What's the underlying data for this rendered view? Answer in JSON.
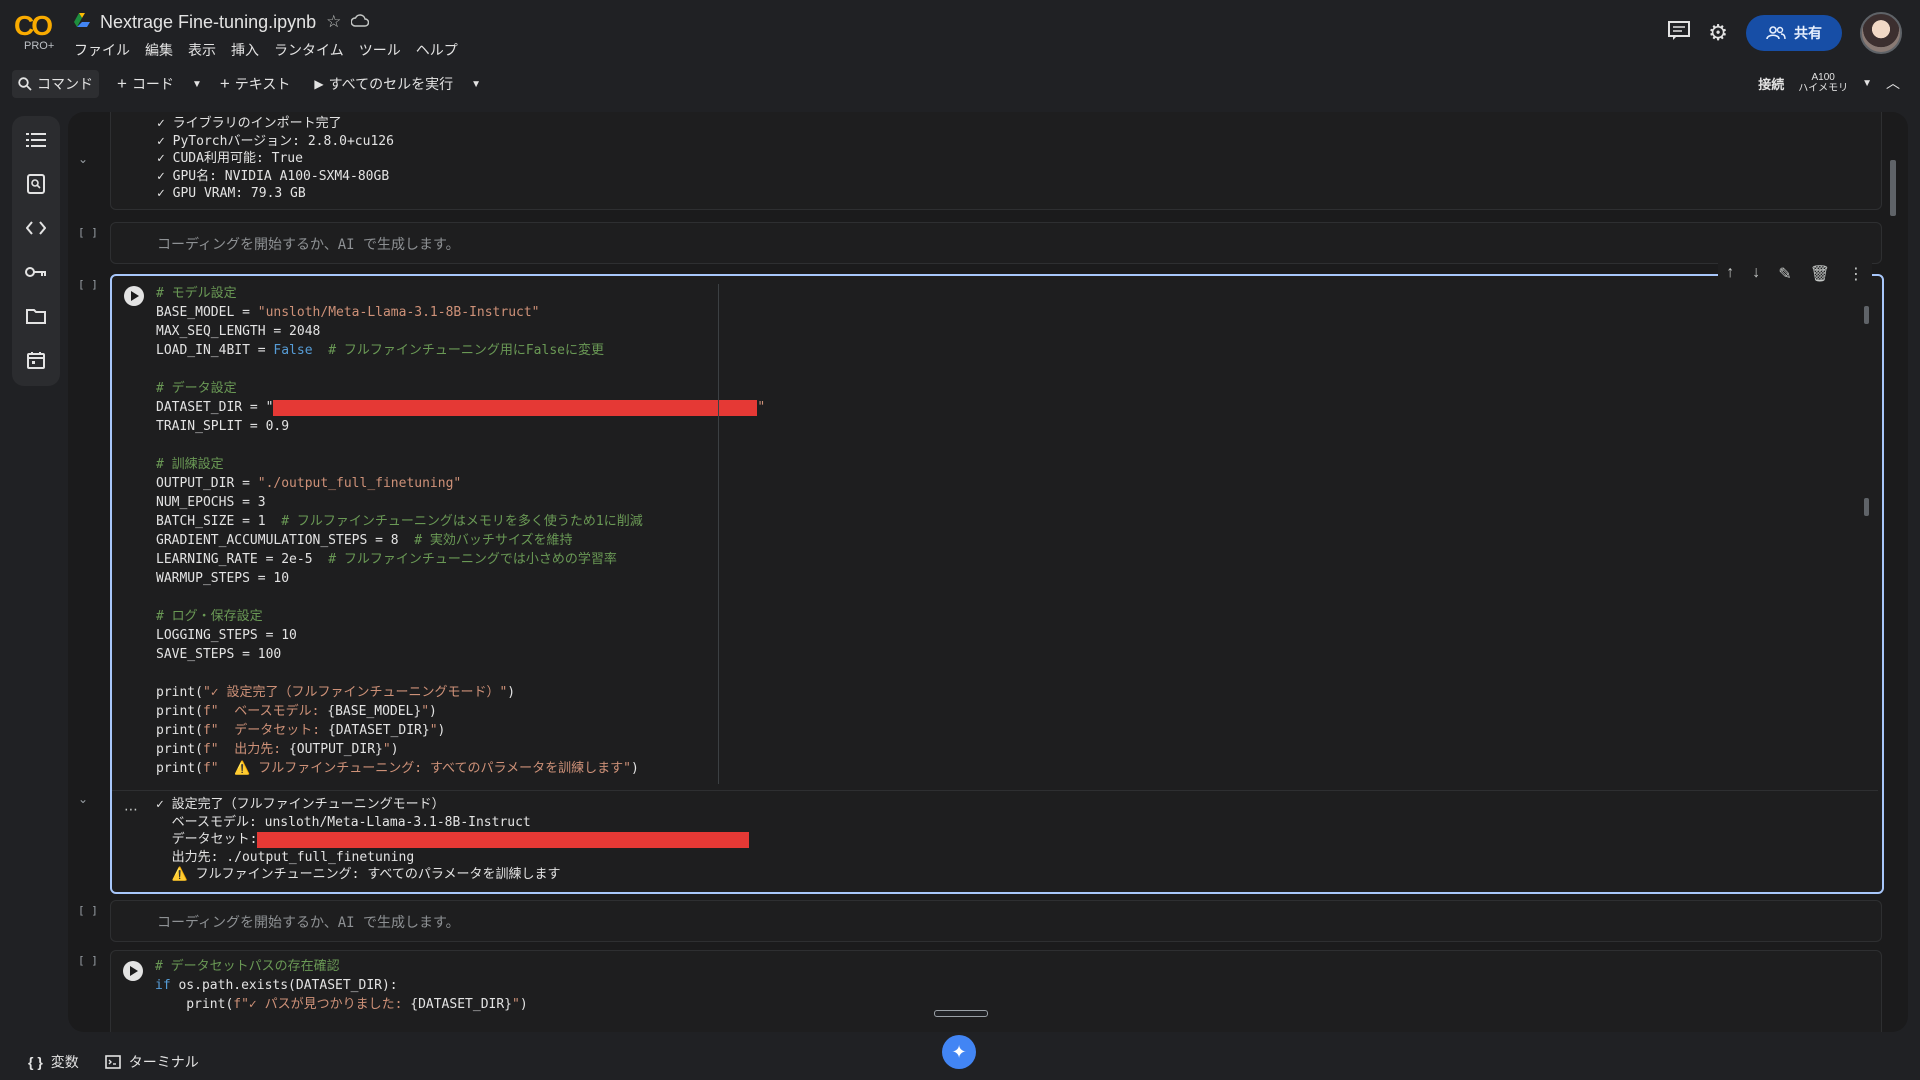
{
  "header": {
    "logo_text": "CO",
    "logo_sub": "PRO+",
    "title": "Nextrage Fine-tuning.ipynb",
    "menu": [
      "ファイル",
      "編集",
      "表示",
      "挿入",
      "ランタイム",
      "ツール",
      "ヘルプ"
    ],
    "share_label": "共有"
  },
  "toolbar": {
    "command_label": "コマンド",
    "code_label": "コード",
    "text_label": "テキスト",
    "run_all_label": "すべてのセルを実行",
    "connect_label": "接続",
    "runtime_line1": "A100",
    "runtime_line2": "ハイメモリ"
  },
  "cells": {
    "output_top": [
      "✓ ライブラリのインポート完了",
      "✓ PyTorchバージョン: 2.8.0+cu126",
      "✓ CUDA利用可能: True",
      "✓ GPU名: NVIDIA A100-SXM4-80GB",
      "✓ GPU VRAM: 79.3 GB"
    ],
    "empty_placeholder": "コーディングを開始するか、AI で生成します。",
    "empty_placeholder_2": "コーディングを開始するか、AI で生成します。",
    "bracket": "[ ]",
    "active_code": [
      {
        "t": "c",
        "v": "# モデル設定"
      },
      {
        "t": "mix",
        "parts": [
          [
            "n",
            "BASE_MODEL = "
          ],
          [
            "s",
            "\"unsloth/Meta-Llama-3.1-8B-Instruct\""
          ]
        ]
      },
      {
        "t": "n",
        "v": "MAX_SEQ_LENGTH = 2048"
      },
      {
        "t": "mix",
        "parts": [
          [
            "n",
            "LOAD_IN_4BIT = "
          ],
          [
            "k",
            "False"
          ],
          [
            "c",
            "  # フルファインチューニング用にFalseに変更"
          ]
        ]
      },
      {
        "t": "n",
        "v": ""
      },
      {
        "t": "c",
        "v": "# データ設定"
      },
      {
        "t": "redact",
        "pre": "DATASET_DIR = \"",
        "post": "\""
      },
      {
        "t": "n",
        "v": "TRAIN_SPLIT = 0.9"
      },
      {
        "t": "n",
        "v": ""
      },
      {
        "t": "c",
        "v": "# 訓練設定"
      },
      {
        "t": "mix",
        "parts": [
          [
            "n",
            "OUTPUT_DIR = "
          ],
          [
            "s",
            "\"./output_full_finetuning\""
          ]
        ]
      },
      {
        "t": "n",
        "v": "NUM_EPOCHS = 3"
      },
      {
        "t": "mix",
        "parts": [
          [
            "n",
            "BATCH_SIZE = 1  "
          ],
          [
            "c",
            "# フルファインチューニングはメモリを多く使うため1に削減"
          ]
        ]
      },
      {
        "t": "mix",
        "parts": [
          [
            "n",
            "GRADIENT_ACCUMULATION_STEPS = 8  "
          ],
          [
            "c",
            "# 実効バッチサイズを維持"
          ]
        ]
      },
      {
        "t": "mix",
        "parts": [
          [
            "n",
            "LEARNING_RATE = 2e-5  "
          ],
          [
            "c",
            "# フルファインチューニングでは小さめの学習率"
          ]
        ]
      },
      {
        "t": "n",
        "v": "WARMUP_STEPS = 10"
      },
      {
        "t": "n",
        "v": ""
      },
      {
        "t": "c",
        "v": "# ログ・保存設定"
      },
      {
        "t": "n",
        "v": "LOGGING_STEPS = 10"
      },
      {
        "t": "n",
        "v": "SAVE_STEPS = 100"
      },
      {
        "t": "n",
        "v": ""
      },
      {
        "t": "mix",
        "parts": [
          [
            "n",
            "print("
          ],
          [
            "s",
            "\"✓ 設定完了（フルファインチューニングモード）\""
          ],
          [
            "n",
            ")"
          ]
        ]
      },
      {
        "t": "mix",
        "parts": [
          [
            "n",
            "print("
          ],
          [
            "s",
            "f\"  ベースモデル: "
          ],
          [
            "n",
            "{BASE_MODEL}"
          ],
          [
            "s",
            "\""
          ],
          [
            "n",
            ")"
          ]
        ]
      },
      {
        "t": "mix",
        "parts": [
          [
            "n",
            "print("
          ],
          [
            "s",
            "f\"  データセット: "
          ],
          [
            "n",
            "{DATASET_DIR}"
          ],
          [
            "s",
            "\""
          ],
          [
            "n",
            ")"
          ]
        ]
      },
      {
        "t": "mix",
        "parts": [
          [
            "n",
            "print("
          ],
          [
            "s",
            "f\"  出力先: "
          ],
          [
            "n",
            "{OUTPUT_DIR}"
          ],
          [
            "s",
            "\""
          ],
          [
            "n",
            ")"
          ]
        ]
      },
      {
        "t": "mix",
        "parts": [
          [
            "n",
            "print("
          ],
          [
            "s",
            "f\"  ⚠️ フルファインチューニング: すべてのパラメータを訓練します\""
          ],
          [
            "n",
            ")"
          ]
        ]
      }
    ],
    "active_output": [
      {
        "v": "✓ 設定完了（フルファインチューニングモード）"
      },
      {
        "v": "  ベースモデル: unsloth/Meta-Llama-3.1-8B-Instruct"
      },
      {
        "v": "  データセット:",
        "redact": true
      },
      {
        "v": "  出力先: ./output_full_finetuning"
      },
      {
        "v": "  ⚠️ フルファインチューニング: すべてのパラメータを訓練します"
      }
    ],
    "last_code": [
      {
        "t": "c",
        "v": "# データセットパスの存在確認"
      },
      {
        "t": "mix",
        "parts": [
          [
            "k",
            "if "
          ],
          [
            "n",
            "os.path.exists(DATASET_DIR):"
          ]
        ]
      },
      {
        "t": "mix",
        "parts": [
          [
            "n",
            "    print("
          ],
          [
            "s",
            "f\"✓ パスが見つかりました: "
          ],
          [
            "n",
            "{DATASET_DIR}"
          ],
          [
            "s",
            "\""
          ],
          [
            "n",
            ")"
          ]
        ]
      }
    ]
  },
  "bottom": {
    "variables_label": "変数",
    "terminal_label": "ターミナル"
  },
  "colors": {
    "accent": "#a8c7fa",
    "share_bg": "#174ea6",
    "redaction": "#e53935",
    "comment": "#6a9955",
    "string": "#ce9178",
    "keyword": "#569cd6"
  }
}
